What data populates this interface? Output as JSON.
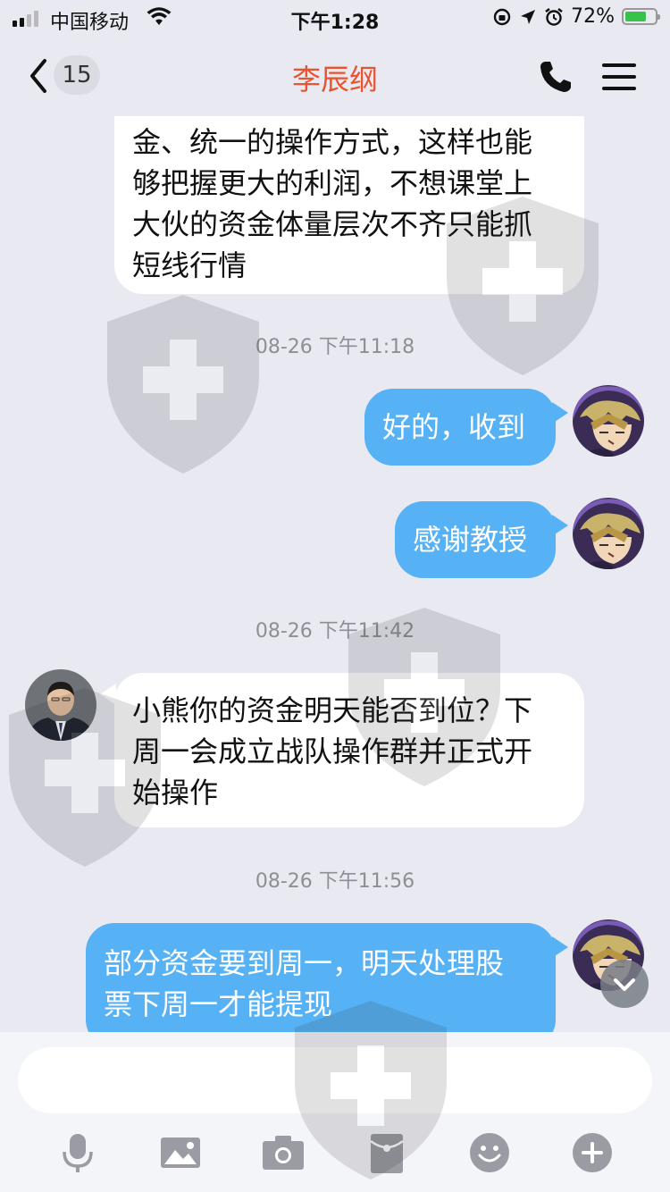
{
  "status_bar": {
    "carrier": "中国移动",
    "time": "下午1:28",
    "battery_percent": "72%",
    "battery_level": 0.72
  },
  "nav": {
    "unread_count": "15",
    "title": "李辰纲",
    "back_icon": "chevron-left-icon",
    "call_icon": "phone-icon",
    "menu_icon": "hamburger-menu-icon"
  },
  "messages": [
    {
      "direction": "in",
      "text_lines": [
        "金、统一的操作方式，这样也能",
        "够把握更大的利润，不想课堂上",
        "大伙的资金体量层次不齐只能抓",
        "短线行情"
      ]
    },
    {
      "timestamp": "08-26 下午11:18"
    },
    {
      "direction": "out",
      "text": "好的，收到"
    },
    {
      "direction": "out",
      "text": "感谢教授"
    },
    {
      "timestamp": "08-26 下午11:42"
    },
    {
      "direction": "in",
      "text_lines": [
        "小熊你的资金明天能否到位？下",
        "周一会成立战队操作群并正式开",
        "始操作"
      ]
    },
    {
      "timestamp": "08-26 下午11:56"
    },
    {
      "direction": "out",
      "text_lines": [
        "部分资金要到周一，明天处理股",
        "票下周一才能提现"
      ]
    }
  ],
  "input": {
    "placeholder": "",
    "value": ""
  },
  "toolbar": [
    "microphone-icon",
    "image-icon",
    "camera-icon",
    "red-packet-icon",
    "emoji-icon",
    "plus-icon"
  ],
  "colors": {
    "background": "#e8e9f1",
    "title": "#e9542e",
    "outgoing_bubble": "#56b2f4",
    "incoming_bubble": "#ffffff",
    "timestamp": "#8e8e95"
  }
}
